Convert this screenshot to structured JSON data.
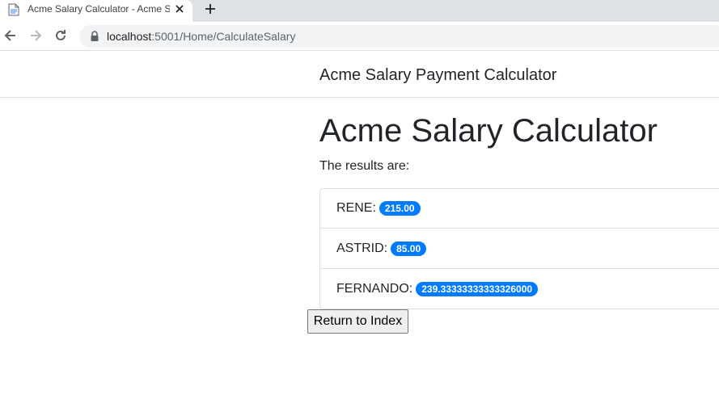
{
  "browser": {
    "tab_title": "Acme Salary Calculator - Acme Sa",
    "url_host": "localhost",
    "url_rest": ":5001/Home/CalculateSalary"
  },
  "navbar": {
    "brand": "Acme Salary Payment Calculator"
  },
  "main": {
    "title": "Acme Salary Calculator",
    "intro": "The results are:",
    "results": [
      {
        "label": "RENE:",
        "value": "215.00"
      },
      {
        "label": "ASTRID:",
        "value": "85.00"
      },
      {
        "label": "FERNANDO:",
        "value": "239.33333333333326000"
      }
    ],
    "return_button": "Return to Index"
  },
  "colors": {
    "badge": "#007bff",
    "tabstrip": "#dee1e6",
    "omnibox": "#f1f3f4"
  },
  "icons": [
    "page-favicon-icon",
    "close-icon",
    "plus-icon",
    "back-arrow-icon",
    "forward-arrow-icon",
    "reload-icon",
    "lock-icon"
  ]
}
